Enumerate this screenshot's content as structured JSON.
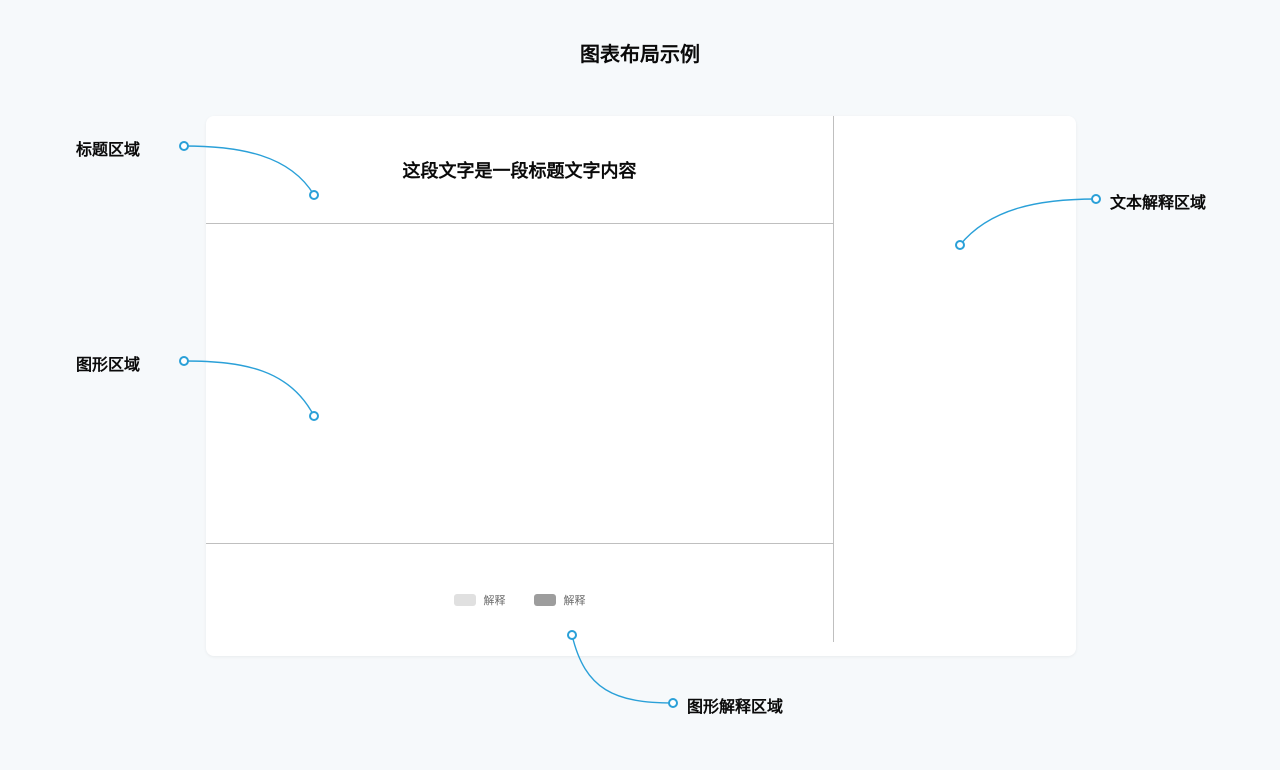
{
  "page": {
    "title": "图表布局示例"
  },
  "card": {
    "title": "这段文字是一段标题文字内容",
    "legend": [
      {
        "label": "解释"
      },
      {
        "label": "解释"
      }
    ]
  },
  "annotations": {
    "title_area": "标题区域",
    "graph_area": "图形区域",
    "text_area": "文本解释区域",
    "legend_area": "图形解释区域"
  }
}
